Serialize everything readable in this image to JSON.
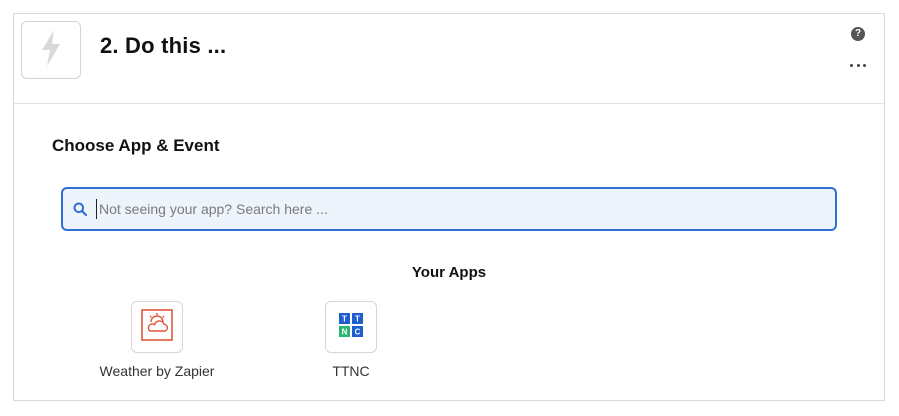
{
  "step": {
    "title": "2. Do this ...",
    "icon": "lightning-bolt-icon"
  },
  "header_actions": {
    "help_icon": "question-circle-icon",
    "help_glyph": "?",
    "more_icon": "ellipsis-icon"
  },
  "section": {
    "title": "Choose App & Event"
  },
  "search": {
    "placeholder": "Not seeing your app? Search here ...",
    "value": "",
    "icon": "search-icon",
    "accent": "#2f6fd1"
  },
  "your_apps": {
    "heading": "Your Apps",
    "items": [
      {
        "label": "Weather by Zapier",
        "icon": "weather-cloud-sun-icon",
        "color": "#e0553a"
      },
      {
        "label": "TTNC",
        "icon": "ttnc-logo-icon",
        "color": "#1d5fd1"
      }
    ]
  },
  "ttnc_logo": {
    "letters": [
      "T",
      "T",
      "N",
      "C"
    ]
  }
}
